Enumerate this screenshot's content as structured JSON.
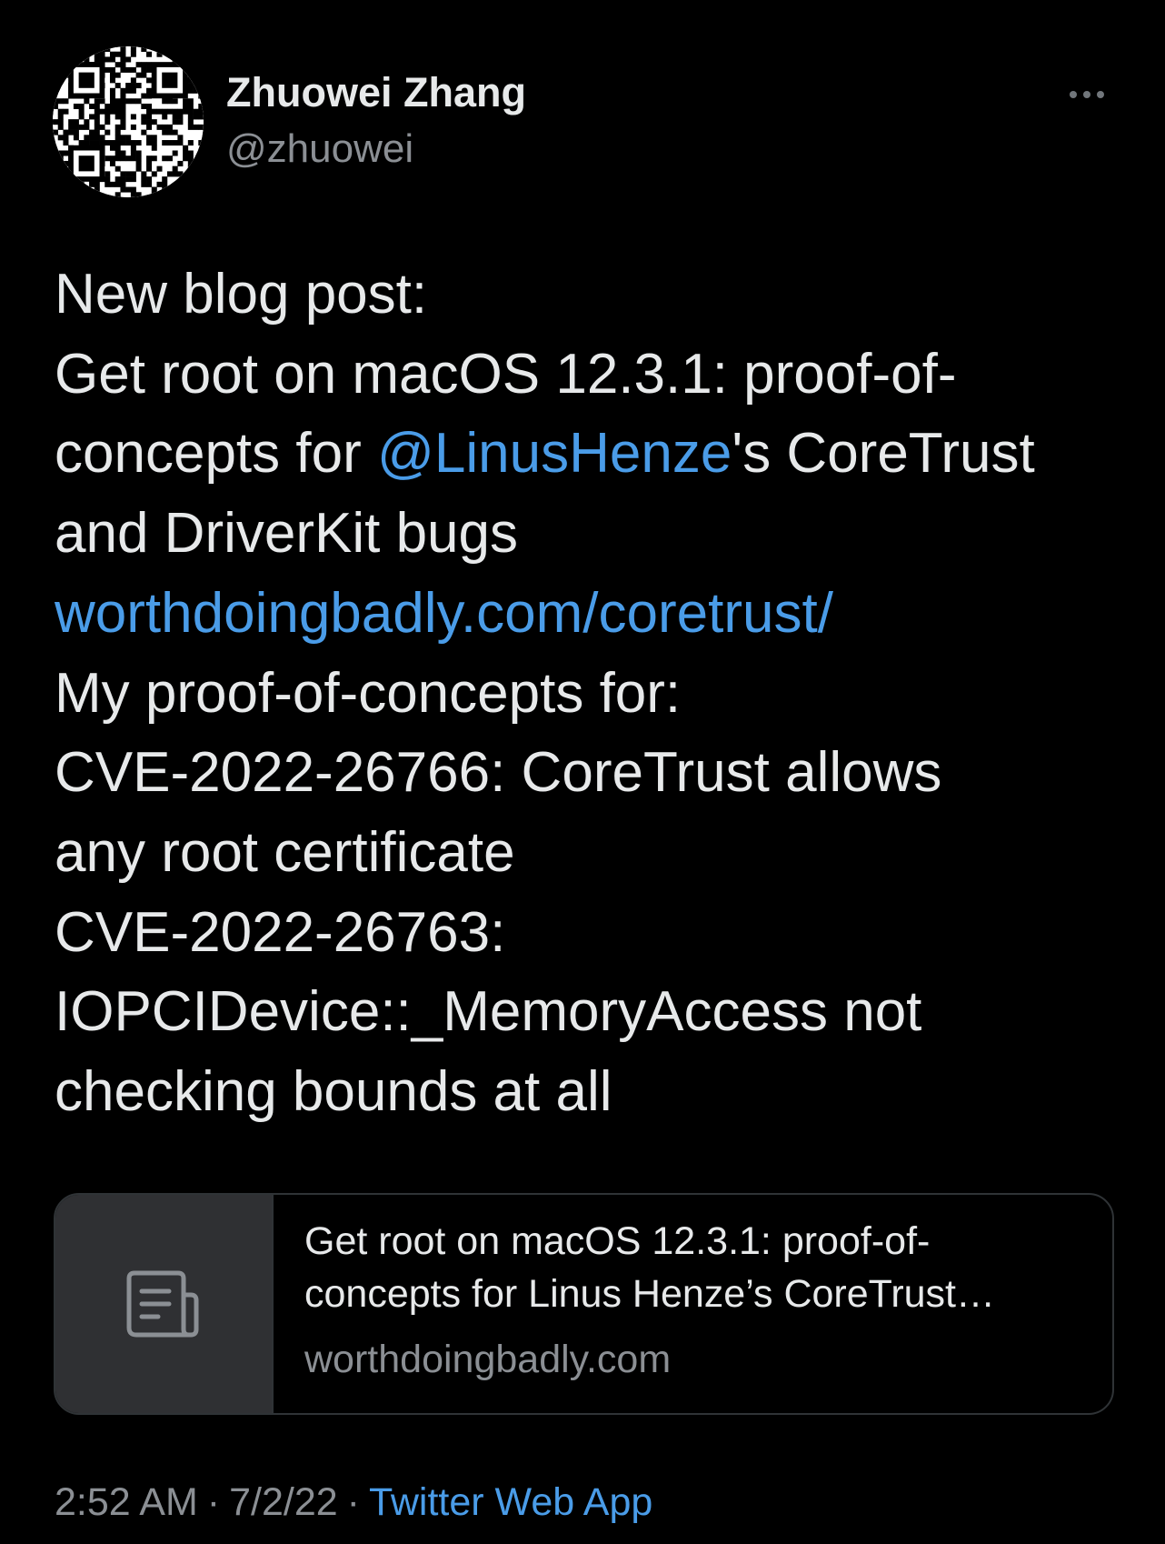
{
  "author": {
    "display_name": "Zhuowei Zhang",
    "handle": "@zhuowei",
    "avatar_icon": "qr-code-avatar"
  },
  "menu": {
    "icon": "more-horizontal-icon"
  },
  "tweet": {
    "lines": [
      {
        "text": "New blog post:"
      },
      {
        "text": "Get root on macOS 12.3.1: proof-of-"
      },
      {
        "before": "concepts for ",
        "mention": "@LinusHenze",
        "after": "'s CoreTrust"
      },
      {
        "text": "and DriverKit bugs"
      },
      {
        "link": "worthdoingbadly.com/coretrust/"
      },
      {
        "text": "My proof-of-concepts for:"
      },
      {
        "text": "CVE-2022-26766: CoreTrust allows"
      },
      {
        "text": "any root certificate"
      },
      {
        "text": "CVE-2022-26763:"
      },
      {
        "text": "IOPCIDevice::_MemoryAccess not"
      },
      {
        "text": "checking bounds at all"
      }
    ]
  },
  "card": {
    "title_line1": "Get root on macOS 12.3.1: proof-of-",
    "title_line2": "concepts for Linus Henze’s CoreTrust…",
    "domain": "worthdoingbadly.com",
    "icon": "article-icon"
  },
  "footer": {
    "time": "2:52 AM",
    "date": "7/2/22",
    "source": "Twitter Web App",
    "separator": "·"
  },
  "colors": {
    "background": "#000000",
    "text": "#e7e9ea",
    "secondary": "#8b8f94",
    "link": "#4a9ce8",
    "border": "#2f3336",
    "card_thumb": "#2f3033"
  }
}
